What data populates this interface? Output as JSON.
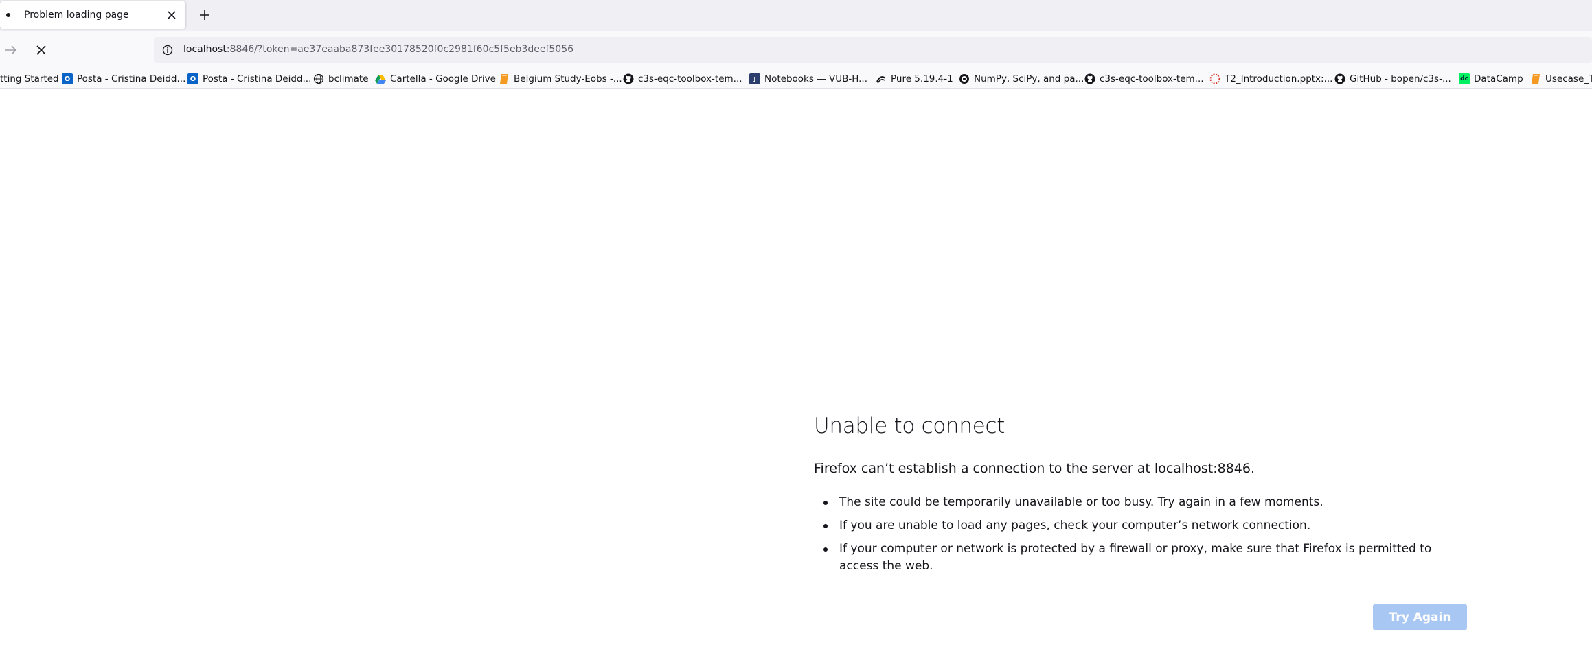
{
  "tab": {
    "title": "Problem loading page"
  },
  "navbar": {
    "url_host": "localhost",
    "url_rest": ":8846/?token=ae37eaaba873fee30178520f0c2981f60c5f5eb3deef5056"
  },
  "bookmarks": [
    {
      "label": "tting Started",
      "icon": "none"
    },
    {
      "label": "Posta - Cristina Deidd...",
      "icon": "outlook-icon"
    },
    {
      "label": "Posta - Cristina Deidd...",
      "icon": "outlook-icon"
    },
    {
      "label": "bclimate",
      "icon": "globe-icon"
    },
    {
      "label": "Cartella - Google Drive",
      "icon": "google-drive-icon"
    },
    {
      "label": "Belgium Study-Eobs -...",
      "icon": "book-icon"
    },
    {
      "label": "c3s-eqc-toolbox-tem...",
      "icon": "github-icon"
    },
    {
      "label": "Notebooks — VUB-H...",
      "icon": "notebook-icon"
    },
    {
      "label": "Pure 5.19.4-1",
      "icon": "pure-icon"
    },
    {
      "label": "NumPy, SciPy, and pa...",
      "icon": "numpy-icon"
    },
    {
      "label": "c3s-eqc-toolbox-tem...",
      "icon": "github-icon"
    },
    {
      "label": "T2_Introduction.pptx:...",
      "icon": "ppt-icon"
    },
    {
      "label": "GitHub - bopen/c3s-...",
      "icon": "github-icon"
    },
    {
      "label": "DataCamp",
      "icon": "datacamp-icon"
    },
    {
      "label": "Usecase_Tr",
      "icon": "book-icon"
    }
  ],
  "error": {
    "title": "Unable to connect",
    "description": "Firefox can’t establish a connection to the server at localhost:8846.",
    "items": [
      "The site could be temporarily unavailable or too busy. Try again in a few moments.",
      "If you are unable to load any pages, check your computer’s network connection.",
      "If your computer or network is protected by a firewall or proxy, make sure that Firefox is permitted to access the web."
    ],
    "button_label": "Try Again"
  },
  "colors": {
    "tabstrip_bg": "#f0f0f4",
    "toolbar_bg": "#f9f9fb",
    "button_bg": "#a9c7f3",
    "text": "#15141a"
  }
}
